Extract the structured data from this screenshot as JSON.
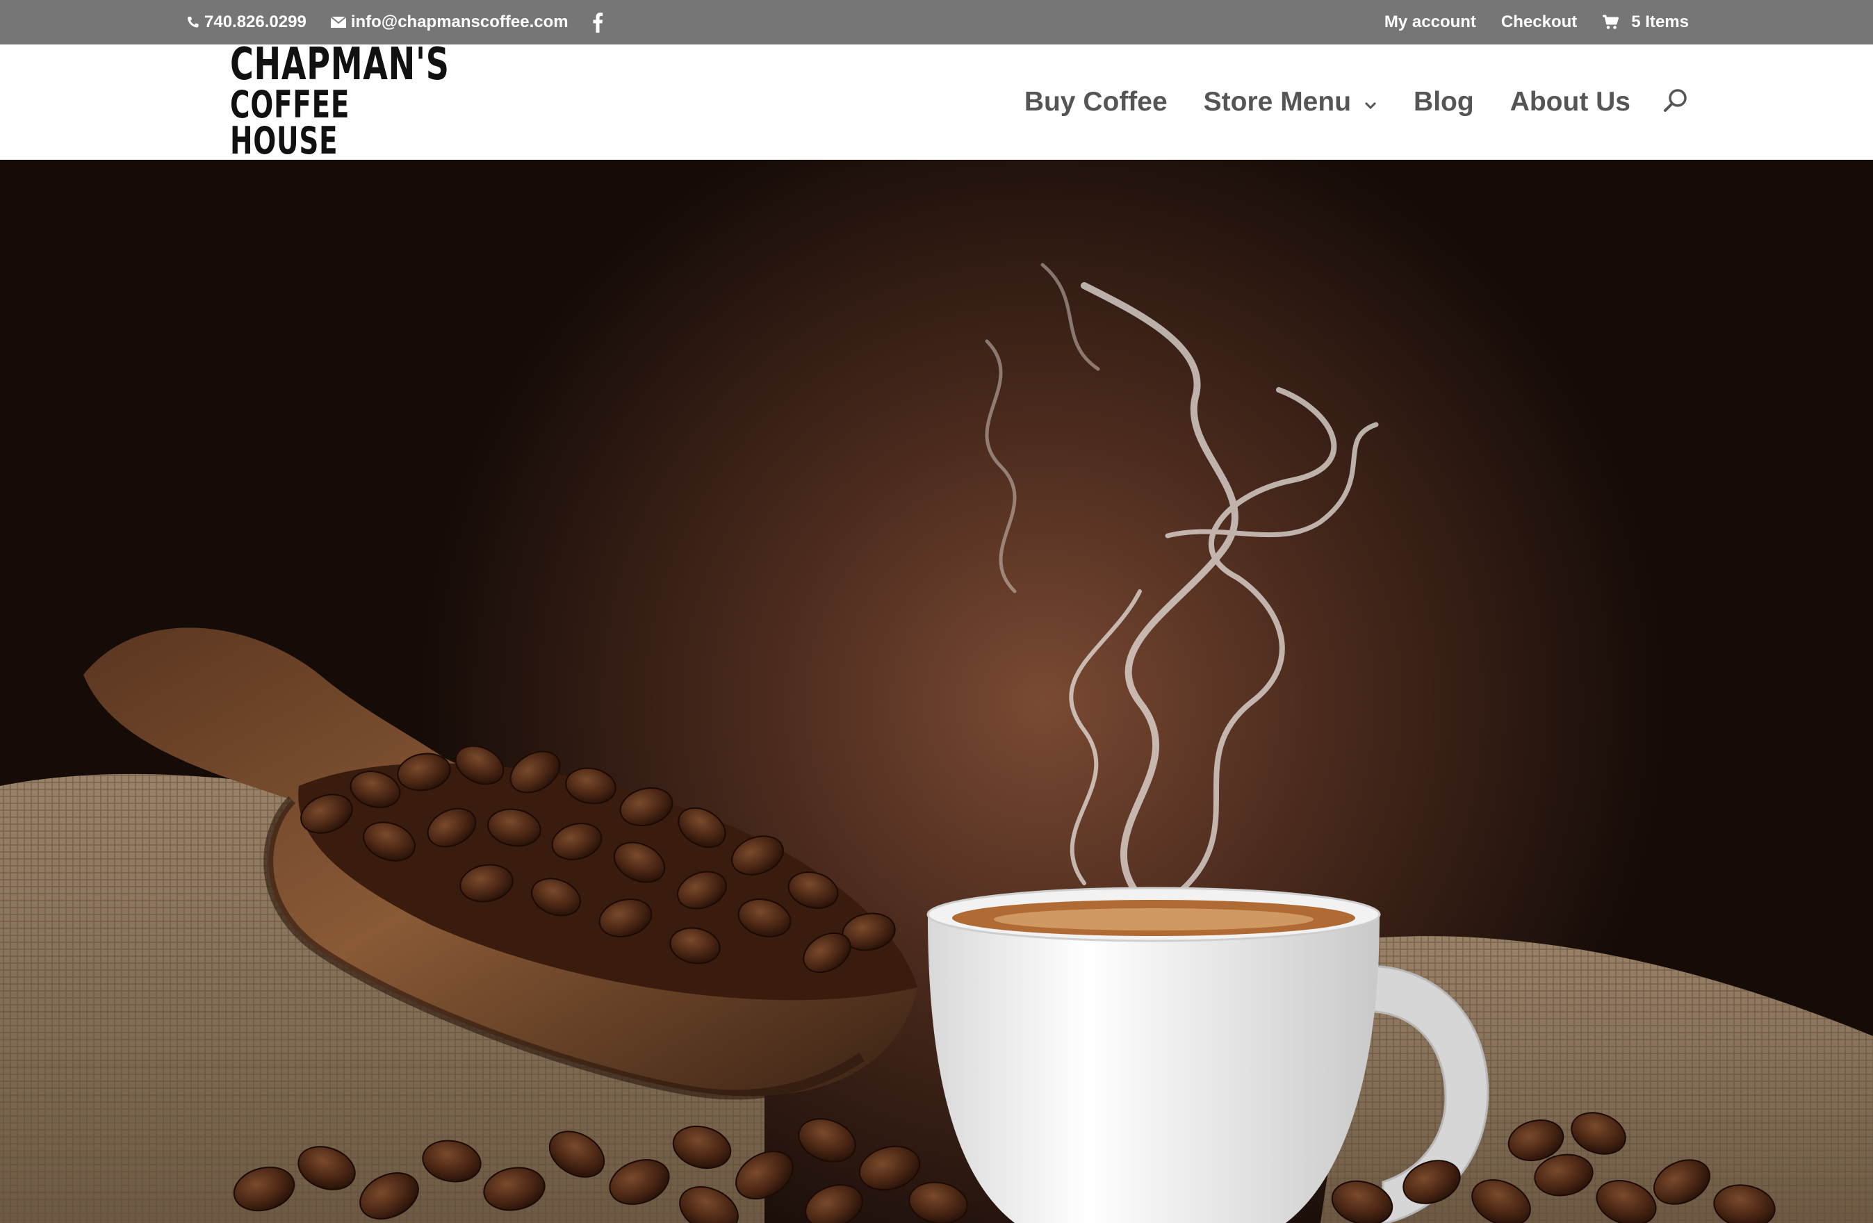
{
  "topbar": {
    "phone": "740.826.0299",
    "email": "info@chapmanscoffee.com",
    "social_icon": "facebook-icon",
    "my_account": "My account",
    "checkout": "Checkout",
    "cart": "5 Items"
  },
  "header": {
    "logo_line1": "CHAPMAN'S",
    "logo_line2": "COFFEE HOUSE",
    "nav": {
      "buy_coffee": "Buy Coffee",
      "store_menu": "Store Menu",
      "blog": "Blog",
      "about_us": "About Us"
    },
    "search_icon": "search-icon"
  },
  "colors": {
    "topbar_bg": "#767676",
    "nav_text": "#555555",
    "header_bg": "#ffffff",
    "hero_brown": "#4a2b1f"
  }
}
